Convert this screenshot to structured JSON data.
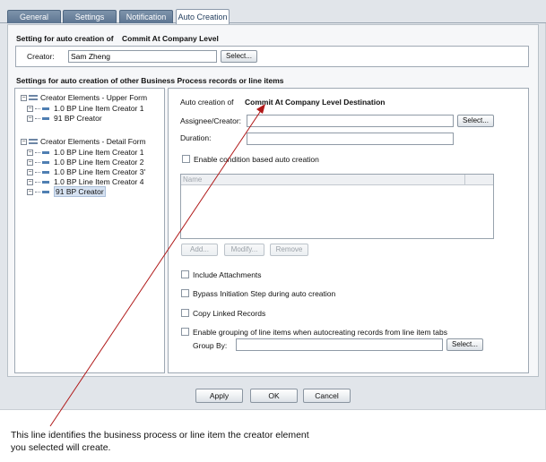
{
  "tabs": [
    {
      "label": "General",
      "active": false
    },
    {
      "label": "Settings",
      "active": false
    },
    {
      "label": "Notification",
      "active": false
    },
    {
      "label": "Auto Creation",
      "active": true
    }
  ],
  "auto_creation_setting": {
    "heading": "Setting for auto creation of",
    "level": "Commit At Company Level",
    "creator_label": "Creator:",
    "creator_value": "Sam Zheng",
    "select_label": "Select..."
  },
  "other_settings_heading": "Settings for auto creation of other Business Process records or line items",
  "tree": {
    "upper_form": {
      "label": "Creator Elements - Upper Form",
      "items": [
        "1.0 BP Line Item Creator 1",
        "91 BP Creator"
      ]
    },
    "detail_form": {
      "label": "Creator Elements - Detail Form",
      "items": [
        "1.0 BP Line Item Creator 1",
        "1.0 BP Line Item Creator 2",
        "1.0 BP Line Item Creator 3'",
        "1.0 BP Line Item Creator 4",
        "91 BP Creator"
      ],
      "selected_index": 4
    }
  },
  "detail": {
    "auto_creation_label": "Auto creation of",
    "destination": "Commit At Company Level Destination",
    "assignee_label": "Assignee/Creator:",
    "assignee_value": "",
    "select_label": "Select...",
    "duration_label": "Duration:",
    "duration_value": "",
    "condition_checkbox": {
      "label": "Enable condition based auto creation",
      "checked": false
    },
    "grid": {
      "columns": [
        "Name",
        ""
      ]
    },
    "grid_buttons": {
      "add": "Add...",
      "modify": "Modify...",
      "remove": "Remove"
    },
    "include_attachments": {
      "label": "Include Attachments",
      "checked": false
    },
    "bypass_initiation": {
      "label": "Bypass Initiation Step during auto creation",
      "checked": false
    },
    "copy_linked": {
      "label": "Copy Linked Records",
      "checked": false
    },
    "enable_grouping": {
      "label": "Enable grouping of line items when autocreating records from line item tabs",
      "checked": false
    },
    "group_by_label": "Group By:",
    "group_by_value": "",
    "group_select_label": "Select..."
  },
  "footer_buttons": {
    "apply": "Apply",
    "ok": "OK",
    "cancel": "Cancel"
  },
  "caption": "This line identifies the business process or line item the creator element you selected will create.",
  "colors": {
    "tab_bg": "#5d7591",
    "panel_bg": "#e1e5ea",
    "arrow": "#b01818",
    "selection": "#d6e2f2"
  }
}
